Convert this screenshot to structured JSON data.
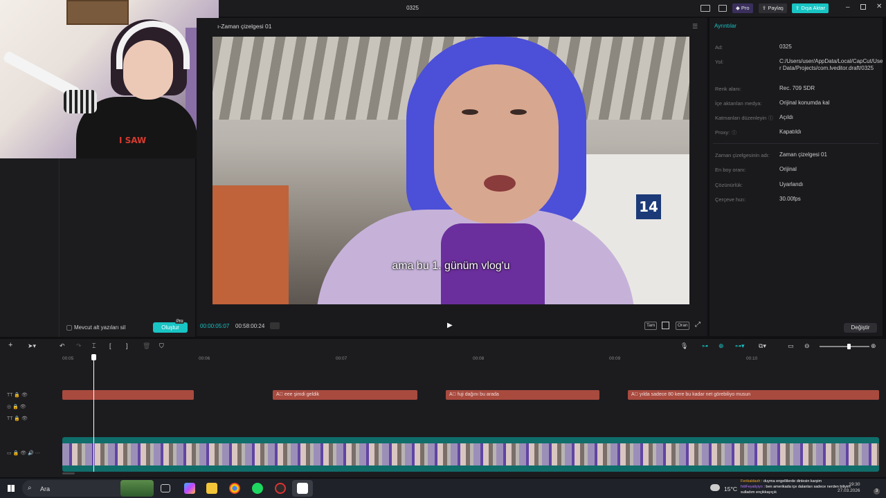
{
  "window": {
    "title": "0325",
    "pro_label": "Pro",
    "share_label": "Paylaş",
    "export_label": "Dışa Aktar"
  },
  "webcam": {
    "shirt_text": "I SAW"
  },
  "left_panel": {
    "delete_subs_label": "Mevcut alt yazıları sil",
    "create_label": "Oluştur",
    "pro_tag": "Pro"
  },
  "player": {
    "title": "ı-Zaman çizelgesi 01",
    "subtitle": "ama bu 1. günüm vlog'u",
    "sign_number": "14",
    "timecode_current": "00:00:05:07",
    "timecode_total": "00:58:00:24",
    "buttons": [
      "Tam",
      "Oran"
    ]
  },
  "details": {
    "tab": "Ayrıntılar",
    "rows": [
      {
        "label": "Ad:",
        "value": "0325"
      },
      {
        "label": "Yol:",
        "value": "C:/Users/user/AppData/Local/CapCut/User Data/Projects/com.lveditor.draft/0325"
      },
      {
        "label": "Renk alanı:",
        "value": "Rec. 709 SDR"
      },
      {
        "label": "İçe aktarılan medya:",
        "value": "Orijinal konumda kal"
      },
      {
        "label": "Katmanları düzenleyin",
        "value": "Açıldı"
      },
      {
        "label": "Proxy:",
        "value": "Kapatıldı"
      },
      {
        "label": "Zaman çizelgesinin adı:",
        "value": "Zaman çizelgesi 01"
      },
      {
        "label": "En boy oranı:",
        "value": "Orijinal"
      },
      {
        "label": "Çözünürlük:",
        "value": "Uyarlandı"
      },
      {
        "label": "Çerçeve hızı:",
        "value": "30.00fps"
      }
    ],
    "change_label": "Değiştir"
  },
  "timeline": {
    "ruler": [
      "00:05",
      "00:06",
      "00:07",
      "00:08",
      "00:09",
      "00:10"
    ],
    "text_clips": [
      "",
      "eee şimdi geldik",
      "fuji dağını bu arada",
      "yılda sadece 80 kere bu kadar net görebiliyo musun"
    ]
  },
  "taskbar": {
    "search_placeholder": "Ara",
    "temperature": "15°C",
    "time": "19:30",
    "date": "27.03.2026",
    "chat_line1_user": "Ferikaldash",
    "chat_line1_text": "duyma engellilerde dinlesin karşim",
    "chat_line2_user": "fxttFeyaliyiyo",
    "chat_line2_text": "ben amerikada içe dalanları sadece nerden biliyim",
    "chat_line3_text": "sulladım ençikkayıçık"
  },
  "colors": {
    "accent": "#19c4c4",
    "clip_red": "#a84a3e",
    "track_teal": "#0f6d6a"
  }
}
